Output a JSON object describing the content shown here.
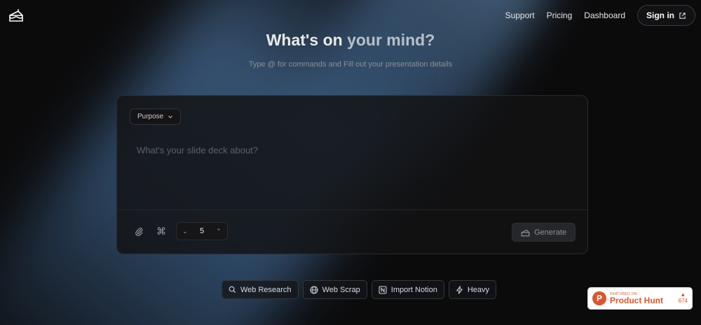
{
  "header": {
    "nav": [
      "Support",
      "Pricing",
      "Dashboard"
    ],
    "signin_label": "Sign in"
  },
  "hero": {
    "title_a": "What's on",
    "title_b": "your mind?",
    "subtitle": "Type @ for commands and Fill out your presentation details"
  },
  "card": {
    "purpose_label": "Purpose",
    "prompt_placeholder": "What's your slide deck about?",
    "slide_count": "5",
    "generate_label": "Generate"
  },
  "chips": [
    {
      "label": "Web Research",
      "icon": "search-icon"
    },
    {
      "label": "Web Scrap",
      "icon": "globe-icon"
    },
    {
      "label": "Import Notion",
      "icon": "notion-icon"
    },
    {
      "label": "Heavy",
      "icon": "bolt-icon"
    }
  ],
  "product_hunt": {
    "featured": "FEATURED ON",
    "name": "Product Hunt",
    "votes": "674"
  },
  "colors": {
    "background": "#0b0b0c",
    "beam": "#5a8cc3",
    "product_hunt": "#da552f"
  }
}
